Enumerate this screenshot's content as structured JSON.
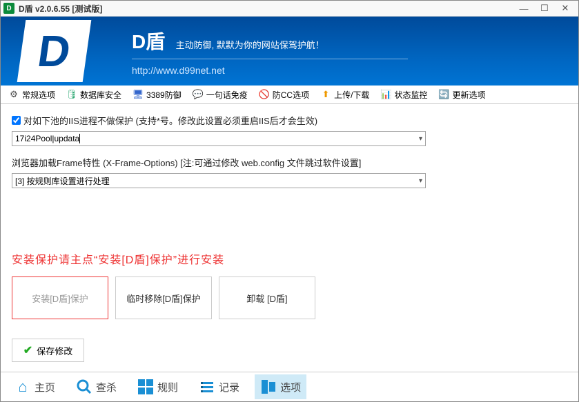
{
  "window": {
    "title": "D盾 v2.0.6.55 [测试版]",
    "icon_label": "D"
  },
  "banner": {
    "logo_letter": "D",
    "title": "D盾",
    "tagline": "主动防御, 默默为你的网站保驾护航！",
    "url": "http://www.d99net.net"
  },
  "toolbar": {
    "items": [
      {
        "icon": "⚙",
        "color": "#444",
        "label": "常规选项"
      },
      {
        "icon": "🛢",
        "color": "#3a7",
        "label": "数据库安全"
      },
      {
        "icon": "🖥",
        "color": "#36c",
        "label": "3389防御"
      },
      {
        "icon": "💬",
        "color": "#cc3",
        "label": "一句话免疫"
      },
      {
        "icon": "🚫",
        "color": "#36c",
        "label": "防CC选项"
      },
      {
        "icon": "⬆",
        "color": "#e90",
        "label": "上传/下载"
      },
      {
        "icon": "📊",
        "color": "#36c",
        "label": "状态监控"
      },
      {
        "icon": "🔄",
        "color": "#c33",
        "label": "更新选项"
      }
    ]
  },
  "settings": {
    "iis_checkbox_label": "对如下池的IIS进程不做保护 (支持*号。修改此设置必须重启IIS后才会生效)",
    "iis_value": "17i24Pool|updata",
    "xframe_label": "浏览器加载Frame特性 (X-Frame-Options)  [注:可通过修改 web.config 文件跳过软件设置]",
    "xframe_value": "[3] 按规则库设置进行处理"
  },
  "instruction": "安装保护请主点“安装[D盾]保护”进行安装",
  "buttons": {
    "install": "安装[D盾]保护",
    "temp_remove": "临时移除[D盾]保护",
    "uninstall": "卸载 [D盾]",
    "save": "保存修改"
  },
  "bottomnav": {
    "items": [
      {
        "key": "home",
        "label": "主页"
      },
      {
        "key": "scan",
        "label": "查杀"
      },
      {
        "key": "rules",
        "label": "规则"
      },
      {
        "key": "log",
        "label": "记录"
      },
      {
        "key": "options",
        "label": "选项"
      }
    ],
    "active": "options"
  }
}
